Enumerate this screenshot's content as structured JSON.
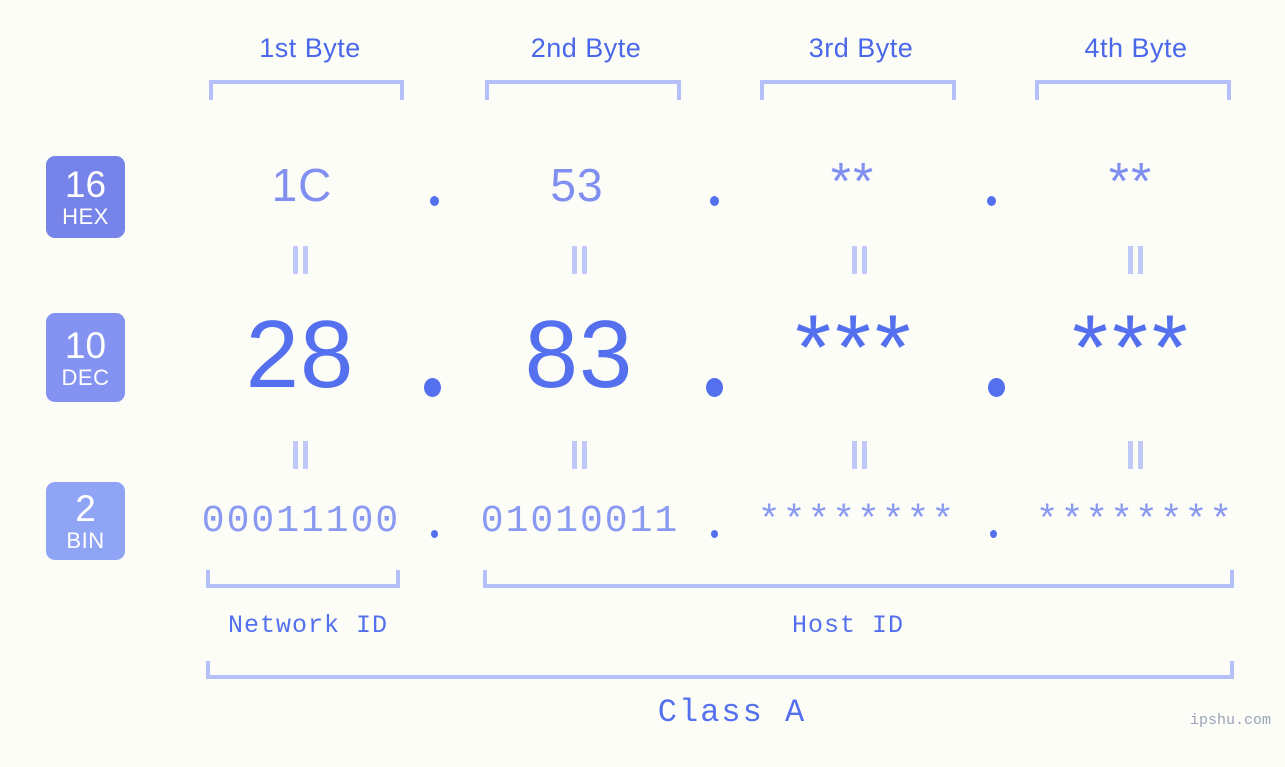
{
  "background_color": "#fbfdf6",
  "accent_color": "#5570ee",
  "light_accent_color": "#b4c0f7",
  "header": {
    "bytes": [
      {
        "label": "1st Byte"
      },
      {
        "label": "2nd Byte"
      },
      {
        "label": "3rd Byte"
      },
      {
        "label": "4th Byte"
      }
    ]
  },
  "rows": [
    {
      "badge": {
        "number": "16",
        "name": "HEX",
        "color": "#7683e8"
      },
      "values": [
        "1C",
        "53",
        "**",
        "**"
      ],
      "separator": "."
    },
    {
      "badge": {
        "number": "10",
        "name": "DEC",
        "color": "#8492f2"
      },
      "values": [
        "28",
        "83",
        "***",
        "***"
      ],
      "separator": "."
    },
    {
      "badge": {
        "number": "2",
        "name": "BIN",
        "color": "#90a4f6"
      },
      "values": [
        "00011100",
        "01010011",
        "********",
        "********"
      ],
      "separator": "."
    }
  ],
  "connectors": {
    "symbol": "=",
    "color": "#bfc8f7"
  },
  "segments": {
    "network_id": "Network ID",
    "host_id": "Host ID"
  },
  "class_label": "Class A",
  "watermark": "ipshu.com"
}
